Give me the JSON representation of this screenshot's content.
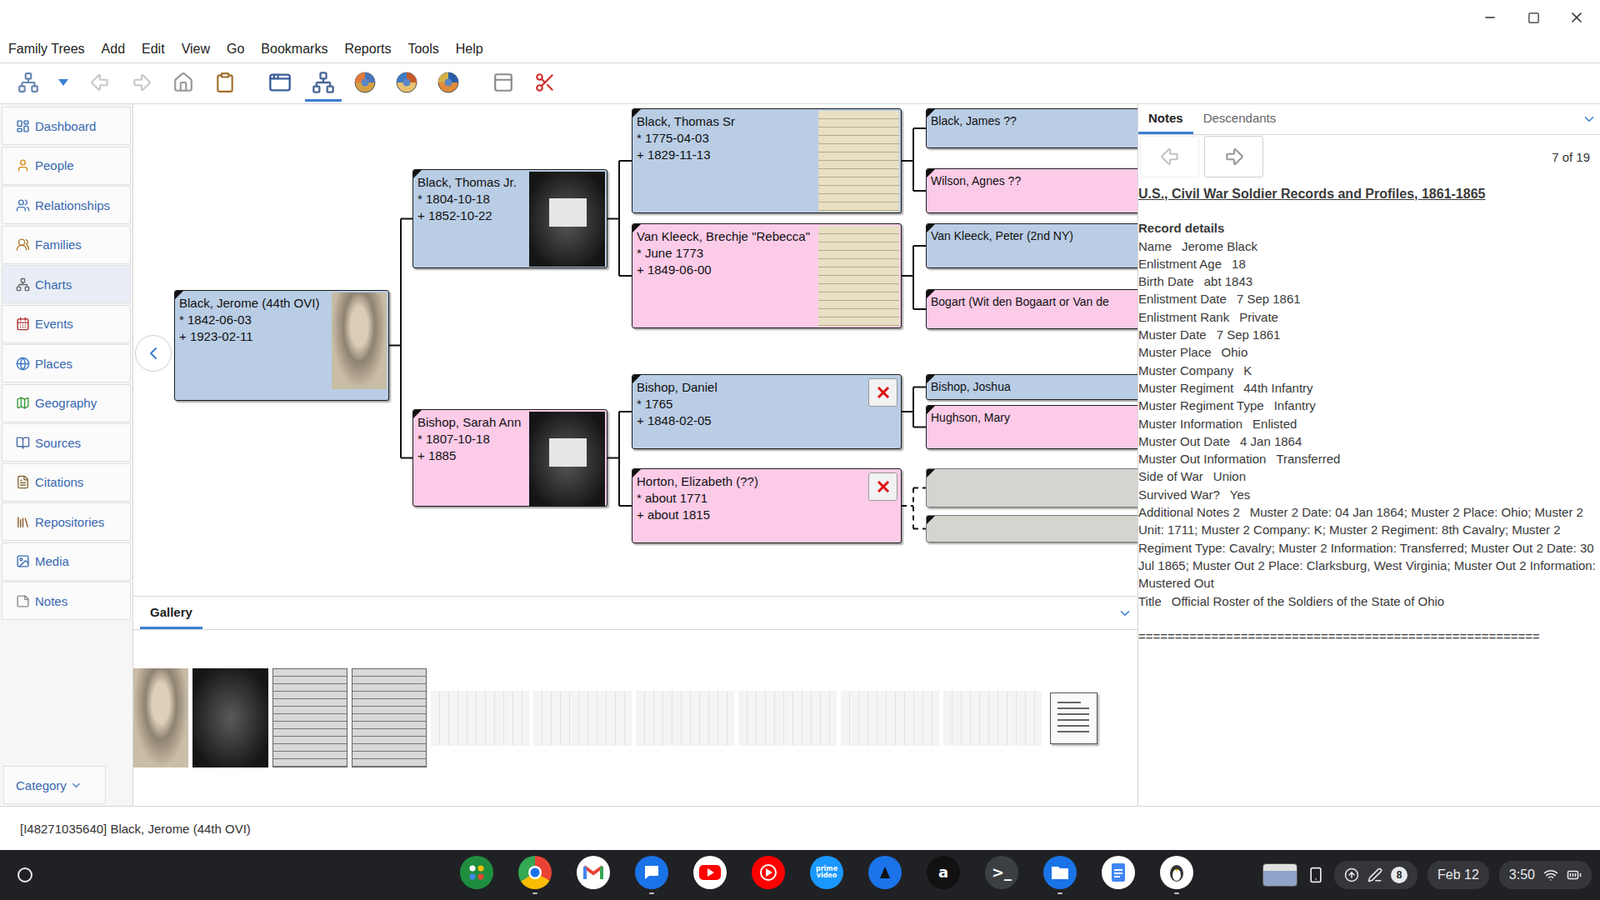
{
  "menu": [
    "Family Trees",
    "Add",
    "Edit",
    "View",
    "Go",
    "Bookmarks",
    "Reports",
    "Tools",
    "Help"
  ],
  "toolbar": [
    {
      "kind": "tree",
      "selected": false,
      "disabled": false
    },
    {
      "kind": "dropdown",
      "selected": false,
      "disabled": false
    },
    {
      "kind": "back",
      "selected": false,
      "disabled": true
    },
    {
      "kind": "forward",
      "selected": false,
      "disabled": true
    },
    {
      "kind": "home",
      "selected": false,
      "disabled": false
    },
    {
      "kind": "clipboard",
      "selected": false,
      "disabled": false
    },
    {
      "kind": "config",
      "selected": false,
      "disabled": false
    },
    {
      "kind": "pedigree",
      "selected": true,
      "disabled": false
    },
    {
      "kind": "fan",
      "selected": false,
      "disabled": false
    },
    {
      "kind": "fan-descendant",
      "selected": false,
      "disabled": false
    },
    {
      "kind": "fan-2way",
      "selected": false,
      "disabled": false
    },
    {
      "kind": "window",
      "selected": false,
      "disabled": false
    },
    {
      "kind": "cut",
      "selected": false,
      "disabled": false
    }
  ],
  "sidebar": {
    "items": [
      {
        "label": "Dashboard",
        "selected": false
      },
      {
        "label": "People",
        "selected": false
      },
      {
        "label": "Relationships",
        "selected": false
      },
      {
        "label": "Families",
        "selected": false
      },
      {
        "label": "Charts",
        "selected": true
      },
      {
        "label": "Events",
        "selected": false
      },
      {
        "label": "Places",
        "selected": false
      },
      {
        "label": "Geography",
        "selected": false
      },
      {
        "label": "Sources",
        "selected": false
      },
      {
        "label": "Citations",
        "selected": false
      },
      {
        "label": "Repositories",
        "selected": false
      },
      {
        "label": "Media",
        "selected": false
      },
      {
        "label": "Notes",
        "selected": false
      }
    ],
    "category": "Category"
  },
  "chart": {
    "people": [
      {
        "name": "Black, Jerome (44th OVI)",
        "birth": "* 1842-06-03",
        "death": "+ 1923-02-11",
        "kind": "male",
        "image": "portrait"
      },
      {
        "name": "Black, Thomas Jr.",
        "birth": "* 1804-10-18",
        "death": "+ 1852-10-22",
        "kind": "male",
        "image": "document"
      },
      {
        "name": "Bishop, Sarah Ann",
        "birth": "* 1807-10-18",
        "death": "+ 1885",
        "kind": "female",
        "image": "document"
      },
      {
        "name": "Black, Thomas Sr",
        "birth": "* 1775-04-03",
        "death": "+ 1829-11-13",
        "kind": "male",
        "image": "parchment"
      },
      {
        "name": "Van Kleeck, Brechje \"Rebecca\"",
        "birth": "* June 1773",
        "death": "+ 1849-06-00",
        "kind": "female",
        "image": "parchment"
      },
      {
        "name": "Bishop, Daniel",
        "birth": "* 1765",
        "death": "+ 1848-02-05",
        "kind": "male",
        "image": "missing"
      },
      {
        "name": "Horton, Elizabeth (??)",
        "birth": "* about 1771",
        "death": "+ about 1815",
        "kind": "female",
        "image": "missing"
      },
      {
        "name": "Black, James ??",
        "kind": "male",
        "image": "none"
      },
      {
        "name": "Wilson, Agnes ??",
        "kind": "female",
        "image": "none"
      },
      {
        "name": "Van Kleeck, Peter (2nd NY)",
        "kind": "male",
        "image": "none"
      },
      {
        "name": "Bogart (Wit den Bogaart or Van de",
        "kind": "female",
        "image": "none"
      },
      {
        "name": "Bishop, Joshua",
        "kind": "male",
        "image": "none"
      },
      {
        "name": "Hughson, Mary",
        "kind": "female",
        "image": "none"
      },
      {
        "kind": "empty",
        "image": "none"
      },
      {
        "kind": "empty",
        "image": "none"
      }
    ]
  },
  "gallery": {
    "tab": "Gallery",
    "thumbnails": [
      {
        "kind": "portrait"
      },
      {
        "kind": "dark-document"
      },
      {
        "kind": "document"
      },
      {
        "kind": "document"
      },
      {
        "kind": "faint"
      },
      {
        "kind": "faint"
      },
      {
        "kind": "faint"
      },
      {
        "kind": "faint"
      },
      {
        "kind": "faint"
      },
      {
        "kind": "faint"
      },
      {
        "kind": "text-file"
      }
    ]
  },
  "notes_panel": {
    "tabs": [
      {
        "label": "Notes",
        "selected": true
      },
      {
        "label": "Descendants",
        "selected": false
      }
    ],
    "counter": "7 of 19",
    "title": "U.S., Civil War Soldier Records and Profiles, 1861-1865",
    "heading": "Record details",
    "fields": [
      {
        "key": "Name",
        "value": "Jerome Black"
      },
      {
        "key": "Enlistment Age",
        "value": "18"
      },
      {
        "key": "Birth Date",
        "value": "abt 1843"
      },
      {
        "key": "Enlistment Date",
        "value": "7 Sep 1861"
      },
      {
        "key": "Enlistment Rank",
        "value": "Private"
      },
      {
        "key": "Muster Date",
        "value": "7 Sep 1861"
      },
      {
        "key": "Muster Place",
        "value": "Ohio"
      },
      {
        "key": "Muster Company",
        "value": "K"
      },
      {
        "key": "Muster Regiment",
        "value": "44th Infantry"
      },
      {
        "key": "Muster Regiment Type",
        "value": "Infantry"
      },
      {
        "key": "Muster Information",
        "value": "Enlisted"
      },
      {
        "key": "Muster Out Date",
        "value": "4 Jan 1864"
      },
      {
        "key": "Muster Out Information",
        "value": "Transferred"
      },
      {
        "key": "Side of War",
        "value": "Union"
      },
      {
        "key": "Survived War?",
        "value": "Yes"
      },
      {
        "key": "Additional Notes 2",
        "value": "Muster 2 Date: 04 Jan 1864; Muster 2 Place: Ohio; Muster 2 Unit: 1711; Muster 2 Company: K; Muster 2 Regiment: 8th Cavalry; Muster 2 Regiment Type: Cavalry; Muster 2 Information: Transferred; Muster Out 2 Date: 30 Jul 1865; Muster Out 2 Place: Clarksburg, West Virginia; Muster Out 2 Information: Mustered Out"
      },
      {
        "key": "Title",
        "value": "Official Roster of the Soldiers of the State of Ohio"
      }
    ],
    "separator": "======================================================="
  },
  "status_bar": "[I48271035640] Black, Jerome (44th OVI)",
  "shelf": {
    "apps": [
      {
        "kind": "apps-grid",
        "running": false
      },
      {
        "kind": "chrome",
        "running": true
      },
      {
        "kind": "gmail",
        "running": false
      },
      {
        "kind": "messages",
        "running": true
      },
      {
        "kind": "youtube",
        "running": false
      },
      {
        "kind": "youtube-music",
        "running": false
      },
      {
        "kind": "prime-video",
        "running": false,
        "glyph": "prime video"
      },
      {
        "kind": "kindle",
        "running": false
      },
      {
        "kind": "amazon",
        "running": false,
        "glyph": "a"
      },
      {
        "kind": "terminal",
        "running": false,
        "glyph": ">_"
      },
      {
        "kind": "files",
        "running": true
      },
      {
        "kind": "docs",
        "running": false
      },
      {
        "kind": "linux",
        "running": true
      }
    ],
    "tray": {
      "badge": "8",
      "date": "Feb 12",
      "time": "3:50"
    }
  }
}
